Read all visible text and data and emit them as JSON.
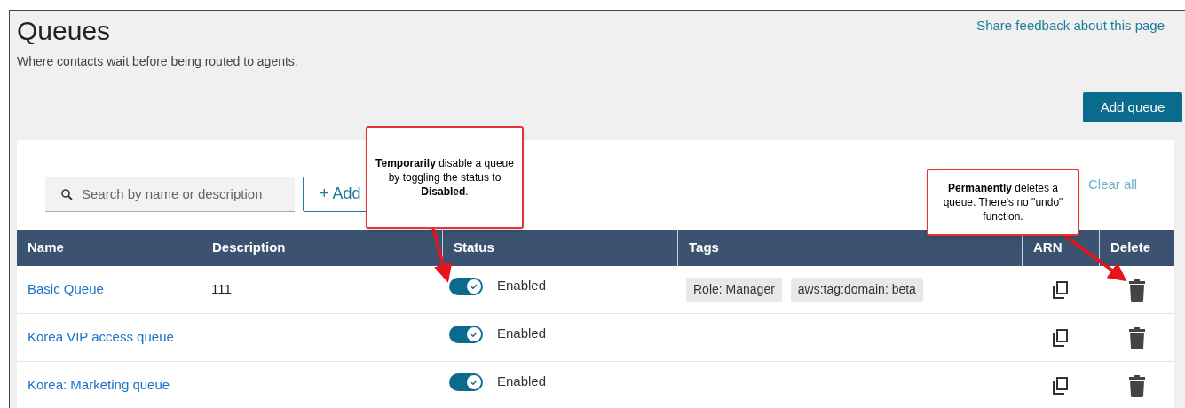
{
  "page": {
    "title": "Queues",
    "subtitle": "Where contacts wait before being routed to agents.",
    "feedback_link": "Share feedback about this page",
    "add_button": "Add queue"
  },
  "toolbar": {
    "search": {
      "placeholder": "Search by name or description"
    },
    "add_filter_button": "+ Add",
    "clear_link": "Clear all"
  },
  "table": {
    "columns": [
      "Name",
      "Description",
      "Status",
      "Tags",
      "ARN",
      "Delete"
    ],
    "rows": [
      {
        "name": "Basic Queue",
        "description": "111",
        "status": {
          "on": true,
          "label": "Enabled"
        },
        "tags": [
          "Role: Manager",
          "aws:tag:domain: beta"
        ]
      },
      {
        "name": "Korea VIP access queue",
        "status": {
          "on": true,
          "label": "Enabled"
        },
        "tags": []
      },
      {
        "name": "Korea: Marketing queue",
        "status": {
          "on": true,
          "label": "Enabled"
        },
        "tags": []
      }
    ]
  },
  "callouts": [
    {
      "text": "**Temporarily** disable a queue by toggling the status to **Disabled**."
    },
    {
      "text": "**Permanently** deletes a queue. There's no \"undo\" function."
    }
  ]
}
